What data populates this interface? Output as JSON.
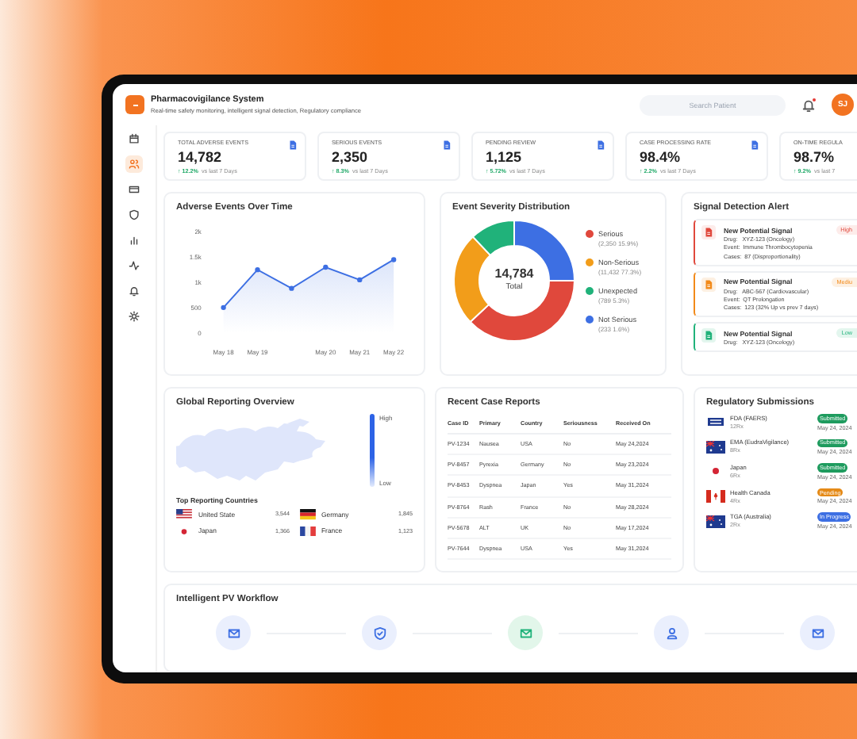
{
  "app": {
    "title": "Pharmacovigilance System",
    "subtitle": "Real-time safety monitoring, intelligent signal detection, Regulatory compliance"
  },
  "search": {
    "placeholder": "Search Patient"
  },
  "notifications": {
    "unread": true
  },
  "user": {
    "initials": "SJ"
  },
  "sidebar": {
    "items": [
      {
        "kind": "calendar",
        "selected": false
      },
      {
        "kind": "users",
        "selected": true
      },
      {
        "kind": "card",
        "selected": false
      },
      {
        "kind": "shield",
        "selected": false
      },
      {
        "kind": "chart",
        "selected": false
      },
      {
        "kind": "activity",
        "selected": false
      },
      {
        "kind": "bell",
        "selected": false
      },
      {
        "kind": "gear",
        "selected": false
      }
    ]
  },
  "stats": [
    {
      "label": "TOTAL ADVERSE EVENTS",
      "value": "14,782",
      "change": "↑ 12.2%",
      "period": "vs last 7 Days"
    },
    {
      "label": "SERIOUS EVENTS",
      "value": "2,350",
      "change": "↑ 8.3%",
      "period": "vs last 7 Days"
    },
    {
      "label": "PENDING REVIEW",
      "value": "1,125",
      "change": "↑ 5.72%",
      "period": "vs last 7 Days"
    },
    {
      "label": "CASE PROCESSING RATE",
      "value": "98.4%",
      "change": "↑ 2.2%",
      "period": "vs last 7 Days"
    },
    {
      "label": "ON-TIME REGULA",
      "value": "98.7%",
      "change": "↑ 9.2%",
      "period": "vs last 7"
    }
  ],
  "adverse_events": {
    "title": "Adverse Events Over Time",
    "chart_data": {
      "type": "area",
      "categories": [
        "May 18",
        "May 19",
        null,
        "May 20",
        "May 21",
        "May 22"
      ],
      "series": [
        {
          "color": "#3d6fe3",
          "values": [
            500,
            1250,
            880,
            1300,
            1050,
            1450
          ]
        }
      ],
      "ylim": [
        0,
        2000
      ],
      "yticks": [
        {
          "value": 0,
          "label": "0"
        },
        {
          "value": 500,
          "label": "500"
        },
        {
          "value": 1000,
          "label": "1k"
        },
        {
          "value": 1500,
          "label": "1.5k"
        },
        {
          "value": 2000,
          "label": "2k"
        }
      ]
    }
  },
  "severity": {
    "title": "Event Severity Distribution",
    "total": "14,784",
    "total_label": "Total",
    "chart_data": {
      "type": "donut",
      "categories": [
        "Serious",
        "Non-Serious",
        "Unexpected",
        "Not Serious"
      ],
      "series": [
        {
          "values": [
            38,
            25,
            12,
            25
          ]
        }
      ]
    },
    "legend": [
      {
        "detail": "(2,350 15.9%)",
        "color": "#e0483c"
      },
      {
        "detail": "(11,432 77.3%)",
        "color": "#f29d1a"
      },
      {
        "detail": "(789 5.3%)",
        "color": "#20b27a"
      },
      {
        "detail": "(233 1.6%)",
        "color": "#3d6fe3"
      }
    ]
  },
  "signals": {
    "title": "Signal Detection Alert",
    "items": [
      {
        "kind": "high",
        "title": "New Potential Signal",
        "badge": "High",
        "lines": [
          "Drug:   XYZ-123 (Oncology)",
          "Event:  Immune Thrombocytopenia",
          "Cases:  87 (Disproportionality)"
        ]
      },
      {
        "kind": "medium",
        "title": "New Potential Signal",
        "badge": "Mediu",
        "lines": [
          "Drug:   ABC-567 (Cardiovascular)",
          "Event:  QT Prolongation",
          "Cases:  123 (32% Up vs prev 7 days)"
        ]
      },
      {
        "kind": "low",
        "title": "New Potential Signal",
        "badge": "Low",
        "lines": [
          "Drug:   XYZ-123 (Oncology)"
        ]
      }
    ]
  },
  "global": {
    "title": "Global Reporting Overview",
    "legend_high": "High",
    "legend_low": "Low",
    "countries_title": "Top Reporting Countries",
    "countries": [
      {
        "kind": "us",
        "name": "United State",
        "count": "3,544"
      },
      {
        "kind": "de",
        "name": "Germany",
        "count": "1,845"
      },
      {
        "kind": "jp",
        "name": "Japan",
        "count": "1,366"
      },
      {
        "kind": "fr",
        "name": "France",
        "count": "1,123"
      }
    ]
  },
  "cases": {
    "title": "Recent Case Reports",
    "columns": [
      "Case ID",
      "Primary",
      "Country",
      "Seriousness",
      "Received On"
    ],
    "rows": [
      [
        "PV-1234",
        "Nausea",
        "USA",
        "No",
        "May 24,2024"
      ],
      [
        "PV-8457",
        "Pyrexia",
        "Germany",
        "No",
        "May 23,2024"
      ],
      [
        "PV-8453",
        "Dyspnea",
        "Japan",
        "Yes",
        "May 31,2024"
      ],
      [
        "PV-8764",
        "Rash",
        "France",
        "No",
        "May 28,2024"
      ],
      [
        "PV-5678",
        "ALT",
        "UK",
        "No",
        "May 17,2024"
      ],
      [
        "PV-7644",
        "Dyspnea",
        "USA",
        "Yes",
        "May 31,2024"
      ]
    ]
  },
  "submissions": {
    "title": "Regulatory Submissions",
    "items": [
      {
        "kind": "fda",
        "name": "FDA (FAERS)",
        "sub": "12Rx",
        "status": "Submitted",
        "color": "#1e9b5e",
        "date": "May 24, 2024"
      },
      {
        "kind": "au",
        "name": "EMA (EudraVigilance)",
        "sub": "8Rx",
        "status": "Submitted",
        "color": "#1e9b5e",
        "date": "May 24, 2024"
      },
      {
        "kind": "jp",
        "name": "Japan",
        "sub": "6Rx",
        "status": "Submitted",
        "color": "#1e9b5e",
        "date": "May 24, 2024"
      },
      {
        "kind": "ca",
        "name": "Health Canada",
        "sub": "4Rx",
        "status": "Pending",
        "color": "#e58a17",
        "date": "May 24, 2024"
      },
      {
        "kind": "au",
        "name": "TGA (Australia)",
        "sub": "2Rx",
        "status": "In Progress",
        "color": "#3d6fe3",
        "date": "May 24, 2024"
      }
    ]
  },
  "workflow": {
    "title": "Intelligent PV Workflow",
    "steps": [
      {
        "kind": "mail",
        "completed": false
      },
      {
        "kind": "shield",
        "completed": false
      },
      {
        "kind": "mail",
        "completed": true
      },
      {
        "kind": "user",
        "completed": false
      },
      {
        "kind": "mail",
        "completed": false
      }
    ]
  }
}
